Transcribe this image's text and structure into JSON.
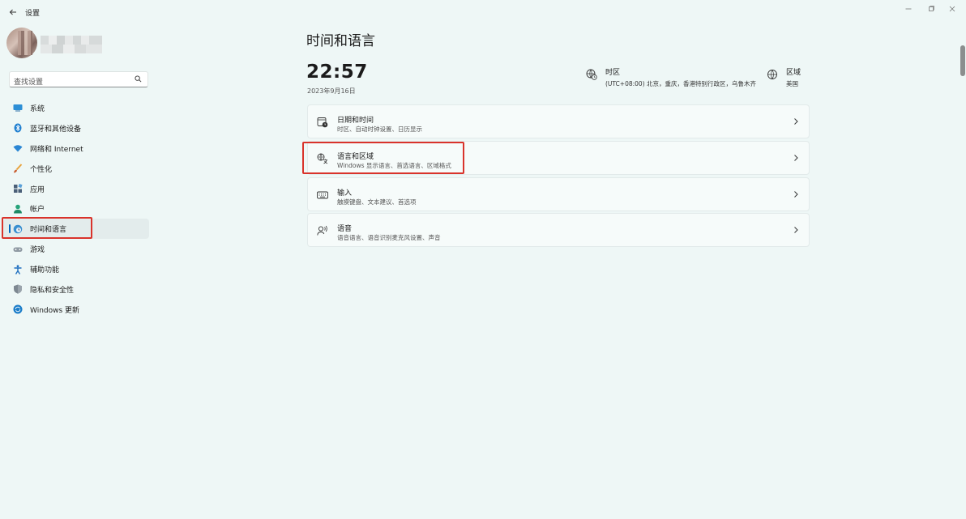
{
  "window": {
    "title": "设置"
  },
  "search": {
    "placeholder": "查找设置"
  },
  "sidebar": {
    "items": [
      {
        "label": "系统",
        "icon": "monitor-icon"
      },
      {
        "label": "蓝牙和其他设备",
        "icon": "bluetooth-icon"
      },
      {
        "label": "网络和 Internet",
        "icon": "wifi-icon"
      },
      {
        "label": "个性化",
        "icon": "brush-icon"
      },
      {
        "label": "应用",
        "icon": "apps-icon"
      },
      {
        "label": "帐户",
        "icon": "person-icon"
      },
      {
        "label": "时间和语言",
        "icon": "globe-clock-icon",
        "selected": true
      },
      {
        "label": "游戏",
        "icon": "gamepad-icon"
      },
      {
        "label": "辅助功能",
        "icon": "accessibility-icon"
      },
      {
        "label": "隐私和安全性",
        "icon": "shield-icon"
      },
      {
        "label": "Windows 更新",
        "icon": "update-icon"
      }
    ]
  },
  "main": {
    "title": "时间和语言",
    "clock": "22:57",
    "date": "2023年9月16日",
    "timezone": {
      "label": "时区",
      "value": "(UTC+08:00) 北京，重庆，香港特别行政区，乌鲁木齐"
    },
    "region": {
      "label": "区域",
      "value": "美国"
    },
    "cards": [
      {
        "title": "日期和时间",
        "subtitle": "时区、自动时钟设置、日历显示",
        "icon": "calendar-clock-icon"
      },
      {
        "title": "语言和区域",
        "subtitle": "Windows 显示语言、首选语言、区域格式",
        "icon": "language-icon"
      },
      {
        "title": "输入",
        "subtitle": "触摸键盘、文本建议、首选项",
        "icon": "keyboard-icon"
      },
      {
        "title": "语音",
        "subtitle": "语音语言、语音识别麦克风设置、声音",
        "icon": "speech-icon"
      }
    ]
  },
  "colors": {
    "background": "#eef7f6",
    "accent": "#0067c0",
    "highlight": "#d9332b"
  }
}
